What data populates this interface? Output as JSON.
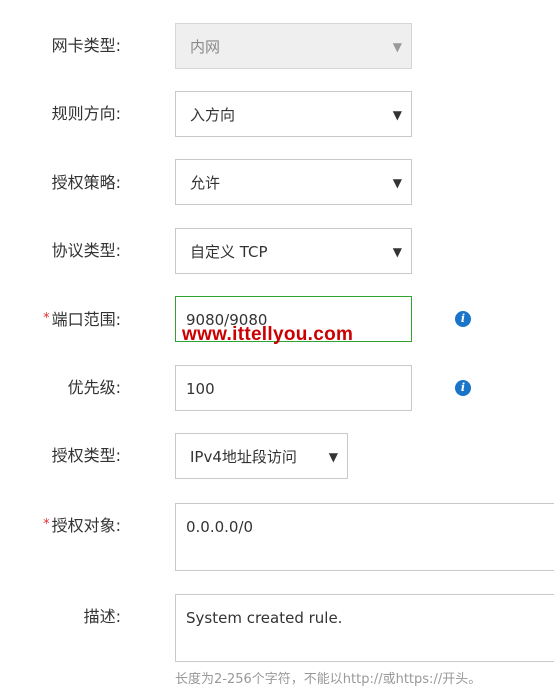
{
  "form": {
    "nic_type": {
      "label": "网卡类型:",
      "value": "内网"
    },
    "rule_direction": {
      "label": "规则方向:",
      "value": "入方向"
    },
    "auth_policy": {
      "label": "授权策略:",
      "value": "允许"
    },
    "protocol_type": {
      "label": "协议类型:",
      "value": "自定义 TCP"
    },
    "port_range": {
      "required_mark": "*",
      "label": "端口范围:",
      "value": "9080/9080"
    },
    "priority": {
      "label": "优先级:",
      "value": "100"
    },
    "auth_type": {
      "label": "授权类型:",
      "value": "IPv4地址段访问"
    },
    "auth_object": {
      "required_mark": "*",
      "label": "授权对象:",
      "value": "0.0.0.0/0"
    },
    "description": {
      "label": "描述:",
      "value": "System created rule.",
      "hint": "长度为2-256个字符，不能以http://或https://开头。"
    }
  },
  "watermark": "www.ittellyou.com",
  "icons": {
    "dropdown": "▼",
    "info": "i"
  },
  "colors": {
    "info_blue": "#1a75c9",
    "focus_green": "#2fa32f",
    "required_red": "#e0302c",
    "watermark_red": "#cc0000"
  }
}
